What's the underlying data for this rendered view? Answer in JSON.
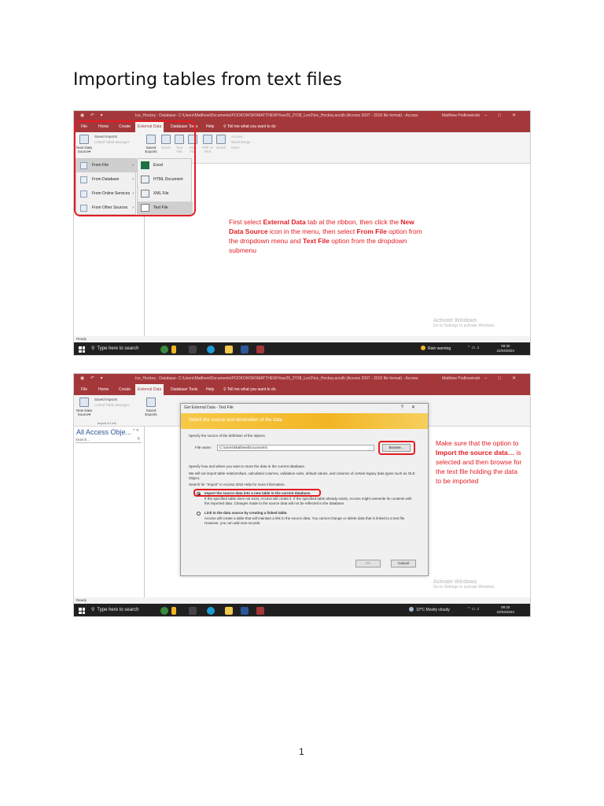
{
  "doc": {
    "title": "Importing tables from text files",
    "page_number": "1"
  },
  "access": {
    "window_title": "Ice_Hockey : Database- C:\\Users\\Matthew\\Documents\\POOKOWSKI\\MATTHEW\\Year26_2Y28_Lev2\\Ice_Hockey.accdb (Access 2007 - 2016 file format) - Access",
    "user": "Matthew Podkowinski",
    "menu": [
      "File",
      "Home",
      "Create",
      "External Data",
      "Database Tools",
      "Help"
    ],
    "tell_me": "Tell me what you want to do",
    "ribbon": {
      "saved_imports": "Saved Imports",
      "linked_table_manager": "Linked Table Manager",
      "new_data_source": "New Data Source",
      "saved_exports": "Saved Exports",
      "excel": "Excel",
      "text_file": "Text File",
      "xml_file": "XML File",
      "pdf_xps": "PDF or XPS",
      "email": "Email",
      "access": "Access",
      "word_merge": "Word Merge",
      "more": "More",
      "import_link_label": "Import & Link"
    },
    "nav_title": "All Access Obje...",
    "nav_search_placeholder": "Search...",
    "status": "Ready"
  },
  "shot1": {
    "dropdown": [
      "From File",
      "From Database",
      "From Online Services",
      "From Other Sources"
    ],
    "submenu": [
      "Excel",
      "HTML Document",
      "XML File",
      "Text File"
    ],
    "annotation": {
      "p1": "First select ",
      "b1": "External Data",
      "p2": " tab at the ribbon, then click the ",
      "b2": "New Data Source",
      "p3": " icon in the menu, then select ",
      "b3": "From File",
      "p4": " option from the dropdown menu and ",
      "b4": "Text File",
      "p5": " option from the dropdown submenu"
    },
    "taskbar_weather": "Rain warning",
    "clock_time": "09:30",
    "clock_date": "22/04/2024"
  },
  "shot2": {
    "dialog": {
      "title": "Get External Data - Text File",
      "banner": "Select the source and destination of the data",
      "specify_source": "Specify the source of the definition of the objects.",
      "file_name_label": "File name:",
      "file_name_value": "C:\\Users\\Matthew\\Documents\\",
      "browse": "Browse...",
      "specify_store": "Specify how and where you want to store the data in the current database.",
      "not_import": "We will not import table relationships, calculated columns, validation rules, default values, and columns of certain legacy data types such as OLE Object.",
      "search_help": "Search for \"Import\" in Access 2016 Help for more information.",
      "opt1": "Import the source data into a new table in the current database.",
      "opt1_desc": "If the specified table does not exist, Access will create it. If the specified table already exists, Access might overwrite its contents with the imported data. Changes made to the source data will not be reflected in the database.",
      "opt2": "Link to the data source by creating a linked table.",
      "opt2_desc": "Access will create a table that will maintain a link to the source data. You cannot change or delete data that is linked to a text file. However, you can add new records.",
      "ok": "OK",
      "cancel": "Cancel"
    },
    "annotation": {
      "p1": "Make sure that the option to ",
      "b1": "Import the source data…",
      "p2": " is selected and then browse for the text file holding the data to be imported"
    },
    "taskbar_weather": "10°C  Mostly cloudy",
    "clock_time": "09:32",
    "clock_date": "22/04/2024"
  },
  "taskbar": {
    "search": "Type here to search"
  },
  "watermark": {
    "line1": "Activate Windows",
    "line2": "Go to Settings to activate Windows."
  },
  "colors": {
    "access_red": "#a4373a",
    "annotation_red": "#e31c23",
    "banner_yellow": "#f2b624"
  }
}
